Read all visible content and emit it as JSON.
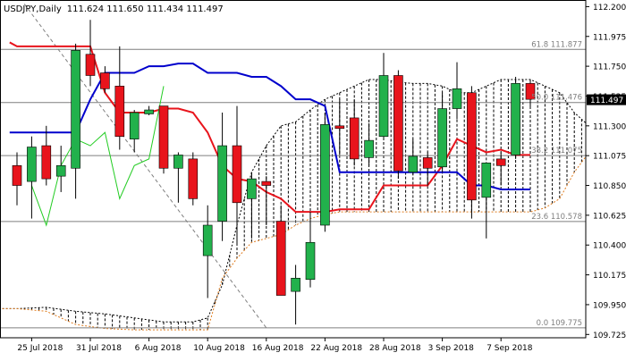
{
  "header": {
    "symbol": "USDJPY",
    "timeframe": "Daily",
    "ohlc": "111.624 111.650 111.434 111.497"
  },
  "colors": {
    "bull": "#22b14c",
    "bear": "#e8141c",
    "tenkan": "#e8141c",
    "kijun": "#0000cc",
    "chikou": "#22cc22",
    "cloud_hatch": "#000000",
    "cloud_span": "#e07c1e",
    "grid": "#7f7f7f",
    "price_label_bg": "#000000"
  },
  "chart_data": {
    "type": "candlestick",
    "title": "USDJPY,Daily",
    "ylim": [
      109.7,
      112.25
    ],
    "y_ticks": [
      "112.200",
      "111.975",
      "111.750",
      "111.525",
      "111.300",
      "111.075",
      "110.850",
      "110.625",
      "110.400",
      "110.175",
      "109.950",
      "109.725"
    ],
    "x_ticks": [
      {
        "label": "25 Jul 2018",
        "index": 1
      },
      {
        "label": "31 Jul 2018",
        "index": 5
      },
      {
        "label": "6 Aug 2018",
        "index": 9
      },
      {
        "label": "10 Aug 2018",
        "index": 13
      },
      {
        "label": "16 Aug 2018",
        "index": 17
      },
      {
        "label": "22 Aug 2018",
        "index": 21
      },
      {
        "label": "28 Aug 2018",
        "index": 25
      },
      {
        "label": "3 Sep 2018",
        "index": 29
      },
      {
        "label": "7 Sep 2018",
        "index": 33
      }
    ],
    "candles": [
      {
        "o": 111.0,
        "h": 111.1,
        "l": 110.7,
        "c": 110.85
      },
      {
        "o": 110.88,
        "h": 111.22,
        "l": 110.6,
        "c": 111.14
      },
      {
        "o": 111.15,
        "h": 111.3,
        "l": 110.85,
        "c": 110.9
      },
      {
        "o": 110.92,
        "h": 111.15,
        "l": 110.8,
        "c": 111.0
      },
      {
        "o": 110.98,
        "h": 111.92,
        "l": 110.75,
        "c": 111.87
      },
      {
        "o": 111.84,
        "h": 112.1,
        "l": 111.6,
        "c": 111.68
      },
      {
        "o": 111.7,
        "h": 111.75,
        "l": 111.55,
        "c": 111.58
      },
      {
        "o": 111.6,
        "h": 111.9,
        "l": 111.12,
        "c": 111.22
      },
      {
        "o": 111.2,
        "h": 111.42,
        "l": 111.1,
        "c": 111.4
      },
      {
        "o": 111.39,
        "h": 111.45,
        "l": 111.38,
        "c": 111.42
      },
      {
        "o": 111.45,
        "h": 111.45,
        "l": 110.94,
        "c": 110.98
      },
      {
        "o": 110.98,
        "h": 111.1,
        "l": 110.72,
        "c": 111.08
      },
      {
        "o": 111.05,
        "h": 111.1,
        "l": 110.7,
        "c": 110.75
      },
      {
        "o": 110.32,
        "h": 110.7,
        "l": 110.0,
        "c": 110.55
      },
      {
        "o": 110.58,
        "h": 111.4,
        "l": 110.43,
        "c": 111.15
      },
      {
        "o": 111.15,
        "h": 111.45,
        "l": 110.4,
        "c": 110.72
      },
      {
        "o": 110.75,
        "h": 110.95,
        "l": 110.45,
        "c": 110.9
      },
      {
        "o": 110.88,
        "h": 110.92,
        "l": 110.55,
        "c": 110.85
      },
      {
        "o": 110.58,
        "h": 110.7,
        "l": 110.05,
        "c": 110.02
      },
      {
        "o": 110.05,
        "h": 110.25,
        "l": 109.8,
        "c": 110.15
      },
      {
        "o": 110.14,
        "h": 110.65,
        "l": 110.08,
        "c": 110.42
      },
      {
        "o": 110.55,
        "h": 111.4,
        "l": 110.5,
        "c": 111.31
      },
      {
        "o": 111.3,
        "h": 111.5,
        "l": 111.08,
        "c": 111.28
      },
      {
        "o": 111.36,
        "h": 111.5,
        "l": 111.0,
        "c": 111.05
      },
      {
        "o": 111.06,
        "h": 111.32,
        "l": 111.0,
        "c": 111.19
      },
      {
        "o": 111.22,
        "h": 111.85,
        "l": 111.2,
        "c": 111.68
      },
      {
        "o": 111.68,
        "h": 111.72,
        "l": 110.9,
        "c": 110.96
      },
      {
        "o": 110.95,
        "h": 111.2,
        "l": 110.93,
        "c": 111.07
      },
      {
        "o": 111.06,
        "h": 111.1,
        "l": 110.85,
        "c": 110.98
      },
      {
        "o": 110.99,
        "h": 111.55,
        "l": 110.95,
        "c": 111.43
      },
      {
        "o": 111.43,
        "h": 111.78,
        "l": 111.35,
        "c": 111.58
      },
      {
        "o": 111.55,
        "h": 111.6,
        "l": 110.6,
        "c": 110.74
      },
      {
        "o": 110.76,
        "h": 111.0,
        "l": 110.45,
        "c": 111.02
      },
      {
        "o": 111.05,
        "h": 111.1,
        "l": 110.85,
        "c": 111.0
      },
      {
        "o": 111.08,
        "h": 111.67,
        "l": 111.05,
        "c": 111.62
      },
      {
        "o": 111.62,
        "h": 111.65,
        "l": 111.43,
        "c": 111.5
      }
    ],
    "last_price": "111.497",
    "series": [
      {
        "name": "",
        "role": "tenkan",
        "x": [
          -0.5,
          0,
          1,
          2,
          3,
          4,
          5,
          6,
          7,
          8,
          9,
          10,
          11,
          12,
          13,
          14,
          15,
          16,
          17,
          18,
          19,
          20,
          21,
          22,
          23,
          24,
          25,
          26,
          27,
          28,
          29,
          30,
          31,
          32,
          33,
          34,
          35
        ],
        "y": [
          111.93,
          111.9,
          111.9,
          111.9,
          111.9,
          111.9,
          111.9,
          111.55,
          111.4,
          111.4,
          111.4,
          111.43,
          111.43,
          111.4,
          111.25,
          111.0,
          110.9,
          110.88,
          110.8,
          110.75,
          110.65,
          110.65,
          110.65,
          110.67,
          110.67,
          110.67,
          110.85,
          110.85,
          110.85,
          110.85,
          111.0,
          111.2,
          111.15,
          111.1,
          111.12,
          111.08,
          111.08
        ]
      },
      {
        "name": "",
        "role": "kijun",
        "x": [
          -0.5,
          0,
          1,
          2,
          3,
          4,
          5,
          6,
          7,
          8,
          9,
          10,
          11,
          12,
          13,
          14,
          15,
          16,
          17,
          18,
          19,
          20,
          21,
          22,
          23,
          24,
          25,
          26,
          27,
          28,
          29,
          30,
          31,
          32,
          33,
          34,
          35
        ],
        "y": [
          111.25,
          111.25,
          111.25,
          111.25,
          111.25,
          111.25,
          111.5,
          111.7,
          111.7,
          111.7,
          111.75,
          111.75,
          111.77,
          111.77,
          111.7,
          111.7,
          111.7,
          111.67,
          111.67,
          111.6,
          111.5,
          111.5,
          111.45,
          110.95,
          110.95,
          110.95,
          110.95,
          110.95,
          110.95,
          110.95,
          110.95,
          110.95,
          110.85,
          110.85,
          110.82,
          110.82,
          110.82
        ]
      },
      {
        "name": "",
        "role": "chikou",
        "x": [
          1,
          2,
          3,
          4,
          5,
          6,
          7,
          8,
          9,
          10
        ],
        "y": [
          110.85,
          110.55,
          111.0,
          111.2,
          111.15,
          111.25,
          110.75,
          111.0,
          111.05,
          111.6
        ]
      }
    ],
    "cloud": {
      "span_a": {
        "x": [
          -1,
          0,
          2,
          4,
          6,
          8,
          10,
          12,
          13,
          14,
          15,
          16,
          17,
          18,
          19,
          20,
          21,
          22,
          23,
          24,
          25,
          26,
          27,
          28,
          29,
          30,
          31,
          32,
          33,
          34,
          35,
          36,
          37,
          38,
          39
        ],
        "y": [
          109.92,
          109.92,
          109.93,
          109.9,
          109.88,
          109.85,
          109.82,
          109.82,
          109.85,
          110.1,
          110.55,
          110.95,
          111.15,
          111.3,
          111.33,
          111.42,
          111.5,
          111.55,
          111.6,
          111.65,
          111.65,
          111.63,
          111.62,
          111.62,
          111.6,
          111.55,
          111.55,
          111.6,
          111.65,
          111.65,
          111.65,
          111.6,
          111.55,
          111.4,
          111.3
        ]
      },
      "span_b": {
        "x": [
          -1,
          0,
          2,
          4,
          6,
          8,
          10,
          12,
          13,
          14,
          15,
          16,
          17,
          18,
          19,
          20,
          21,
          22,
          23,
          24,
          25,
          26,
          27,
          28,
          29,
          30,
          31,
          32,
          33,
          34,
          35,
          36,
          37,
          38,
          39
        ],
        "y": [
          109.92,
          109.92,
          109.9,
          109.8,
          109.77,
          109.76,
          109.76,
          109.76,
          109.76,
          110.15,
          110.3,
          110.42,
          110.45,
          110.48,
          110.55,
          110.6,
          110.63,
          110.65,
          110.65,
          110.65,
          110.65,
          110.65,
          110.65,
          110.65,
          110.65,
          110.65,
          110.65,
          110.65,
          110.65,
          110.65,
          110.65,
          110.68,
          110.75,
          110.95,
          111.1
        ]
      }
    },
    "fib_levels": [
      {
        "label": "61.8 111.877",
        "value": 111.877
      },
      {
        "label": "50.0 111.476",
        "value": 111.476
      },
      {
        "label": "38.2 111.075",
        "value": 111.075
      },
      {
        "label": "23.6 110.578",
        "value": 110.578
      },
      {
        "label": "0.0 109.775",
        "value": 109.775
      }
    ],
    "fib_trendline": {
      "from": {
        "index": 0.5,
        "value": 112.22
      },
      "to": {
        "index": 17,
        "value": 109.775
      }
    },
    "grid": false
  }
}
